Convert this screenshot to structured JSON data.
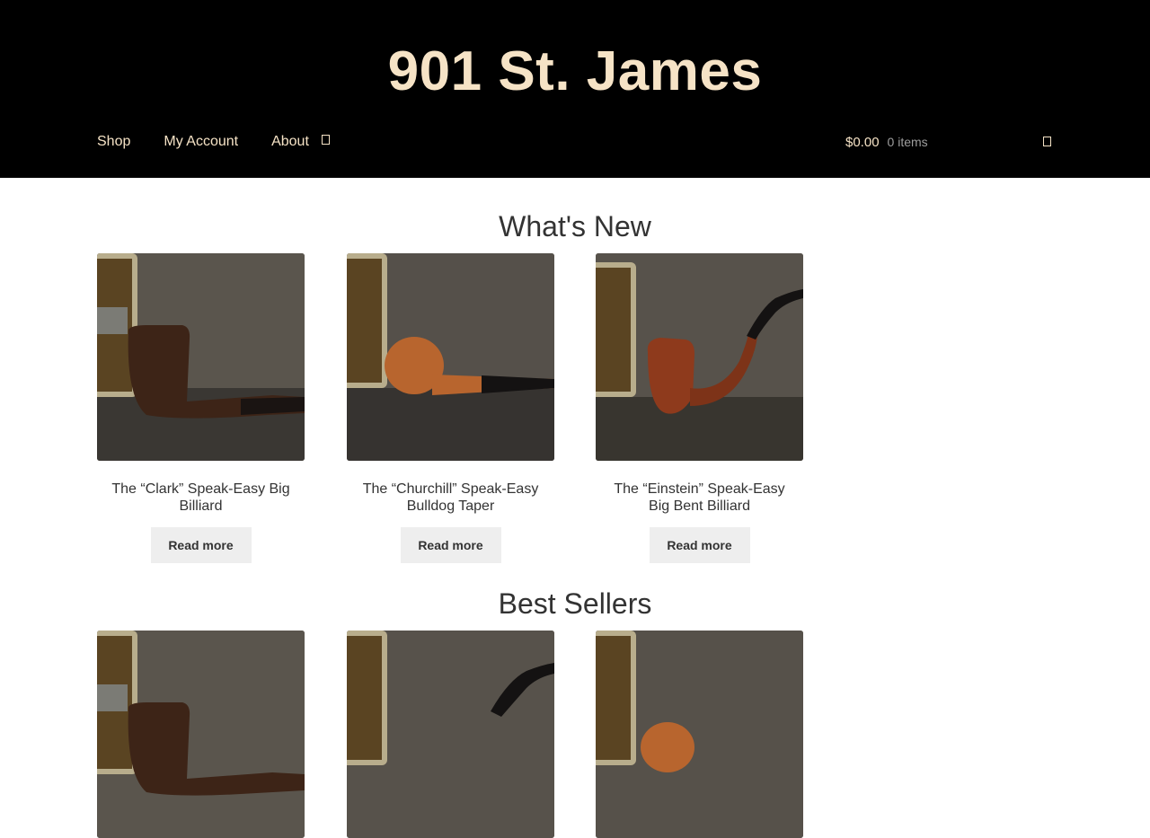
{
  "site": {
    "title": "901 St. James"
  },
  "nav": {
    "items": [
      {
        "label": "Shop"
      },
      {
        "label": "My Account"
      },
      {
        "label": "About"
      }
    ]
  },
  "cart": {
    "amount": "$0.00",
    "items": "0 items"
  },
  "sections": [
    {
      "title": "What's New",
      "products": [
        {
          "name": "The “Clark” Speak-Easy Big Billiard",
          "button": "Read more"
        },
        {
          "name": "The “Churchill” Speak-Easy Bulldog Taper",
          "button": "Read more"
        },
        {
          "name": "The “Einstein” Speak-Easy Big Bent Billiard",
          "button": "Read more"
        }
      ]
    },
    {
      "title": "Best Sellers"
    }
  ],
  "colors": {
    "header_bg": "#000000",
    "brand_text": "#f6e3c6",
    "button_bg": "#eeeeee"
  }
}
